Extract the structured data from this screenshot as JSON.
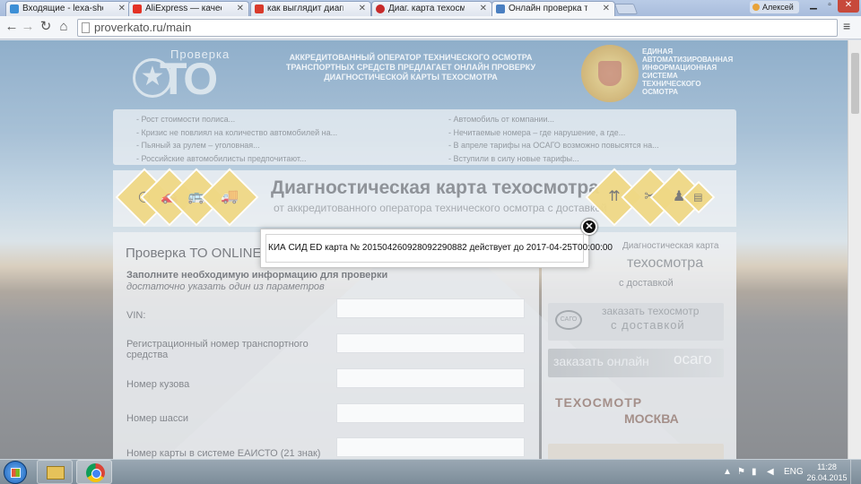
{
  "browser": {
    "tabs": [
      {
        "title": "Входящие - lexa-shok@m",
        "favicon_color": "#3d8fd6"
      },
      {
        "title": "AliExpress — качественн",
        "favicon_color": "#e43225"
      },
      {
        "title": "как выглядит диагностич",
        "favicon_color": "#d93a2b"
      },
      {
        "title": "Диаг. карта техосмотра 2",
        "favicon_color": "#c72a2a"
      },
      {
        "title": "Онлайн проверка техосм",
        "favicon_color": "#4a7fc1"
      }
    ],
    "user_name": "Алексей",
    "url": "proverkato.ru/main"
  },
  "header": {
    "logo_word": "Проверка",
    "logo_big": "ТО",
    "center_text": "АККРЕДИТОВАННЫЙ ОПЕРАТОР ТЕХНИЧЕСКОГО ОСМОТРА ТРАНСПОРТНЫХ СРЕДСТВ ПРЕДЛАГАЕТ ОНЛАЙН ПРОВЕРКУ ДИАГНОСТИЧЕСКОЙ КАРТЫ ТЕХОСМОТРА",
    "right_text": "ЕДИНАЯ АВТОМАТИЗИРОВАННАЯ ИНФОРМАЦИОННАЯ СИСТЕМА ТЕХНИЧЕСКОГО ОСМОТРА"
  },
  "news": {
    "left": [
      "Рост стоимости полиса...",
      "Кризис не повлиял на количество автомобилей на...",
      "Пьяный за рулем – уголовная...",
      "Российские автомобилисты предпочитают..."
    ],
    "right": [
      "Автомобиль от компании...",
      "Нечитаемые номера – где нарушение, а где...",
      "В апреле тарифы на ОСАГО возможно повысятся на...",
      "Вступили в силу новые тарифы..."
    ]
  },
  "banner": {
    "title": "Диагностическая карта техосмотра",
    "subtitle": "от аккредитованного оператора технического осмотра с доставкой"
  },
  "form": {
    "title": "Проверка ТО ONLINE",
    "heading": "Заполните необходимую информацию для проверки",
    "subheading": "достаточно указать один из параметров",
    "fields": [
      {
        "label": "VIN:"
      },
      {
        "label": "Регистрационный номер транспортного средства"
      },
      {
        "label": "Номер кузова"
      },
      {
        "label": "Номер шасси"
      },
      {
        "label": "Номер карты в системе ЕАИСТО (21 знак)"
      }
    ]
  },
  "sidebar": {
    "title1": "Диагностическая карта",
    "title2": "техосмотра",
    "title3": "с доставкой",
    "order_line1": "заказать техосмотр",
    "order_line2": "с доставкой",
    "osago_logo": "САГО",
    "osago_left": "заказать онлайн",
    "osago_right": "осаго",
    "moscow_line1": "ТЕХОСМОТР",
    "moscow_line2": "МОСКВА"
  },
  "modal": {
    "message": "КИА СИД ED карта № 20150426092809229088​2 действует до 2017-04-25T00:00:00"
  },
  "taskbar": {
    "lang": "ENG",
    "time": "11:28",
    "date": "26.04.2015"
  }
}
